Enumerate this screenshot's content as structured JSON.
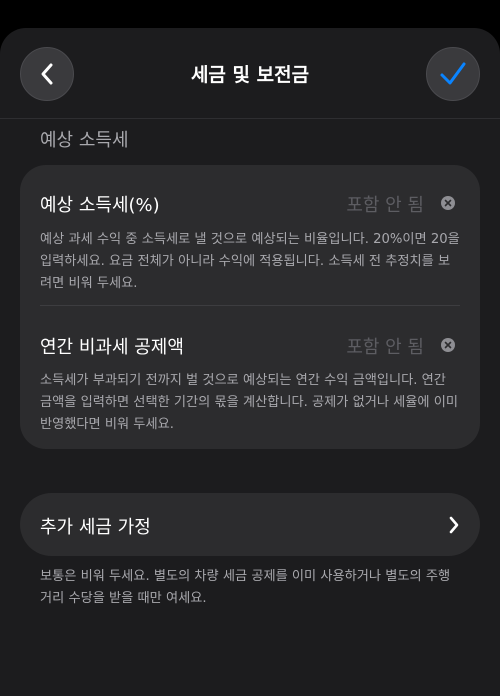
{
  "nav": {
    "title": "세금 및 보전금",
    "back_icon": "chevron-left-icon",
    "confirm_icon": "checkmark-icon"
  },
  "section": {
    "header": "예상 소득세"
  },
  "rows": [
    {
      "title": "예상 소득세(%)",
      "value": "포함 안 됨",
      "description": "예상 과세 수익 중 소득세로 낼 것으로 예상되는 비율입니다. 20%이면 20을 입력하세요. 요금 전체가 아니라 수익에 적용됩니다. 소득세 전 추정치를 보려면 비워 두세요."
    },
    {
      "title": "연간 비과세 공제액",
      "value": "포함 안 됨",
      "description": "소득세가 부과되기 전까지 벌 것으로 예상되는 연간 수익 금액입니다. 연간 금액을 입력하면 선택한 기간의 몫을 계산합니다. 공제가 없거나 세율에 이미 반영했다면 비워 두세요."
    }
  ],
  "additional": {
    "label": "추가 세금 가정",
    "footnote": "보통은 비워 두세요. 별도의 차량 세금 공제를 이미 사용하거나 별도의 주행 거리 수당을 받을 때만 여세요."
  },
  "colors": {
    "accent": "#0a84ff",
    "background": "#1c1c1e",
    "card": "#2c2c2e"
  }
}
